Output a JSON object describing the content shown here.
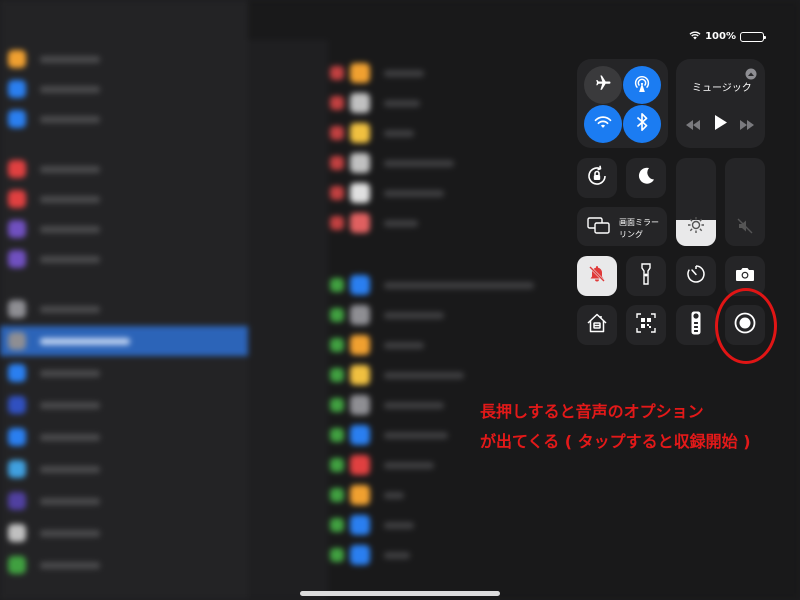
{
  "status_bar": {
    "battery_percent": "100%",
    "battery_level": 1.0
  },
  "control_center": {
    "music": {
      "title": "ミュージック"
    },
    "screen_mirroring": {
      "label_line1": "画面ミラー",
      "label_line2": "リング"
    },
    "brightness_level": 0.3,
    "volume_level": 0.0
  },
  "annotation": {
    "line1": "長押しすると音声のオプション",
    "line2": "が出てくる ( タップすると収録開始 )",
    "color": "#e31919"
  },
  "colors": {
    "accent_blue": "#1b7cf2",
    "annotation_red": "#e01515",
    "battery_green": "#34c759"
  },
  "icons": {
    "airplane": "airplane-icon",
    "airdrop": "airdrop-icon",
    "wifi": "wifi-icon",
    "bluetooth": "bluetooth-icon",
    "rotation_lock": "rotation-lock-icon",
    "do_not_disturb": "moon-icon",
    "mirroring": "screen-mirroring-icon",
    "brightness": "sun-icon",
    "volume": "speaker-muted-icon",
    "mute": "bell-slash-icon",
    "flashlight": "flashlight-icon",
    "timer": "timer-icon",
    "camera": "camera-icon",
    "home": "home-icon",
    "qr": "qr-code-icon",
    "remote": "tv-remote-icon",
    "screen_record": "screen-record-icon"
  }
}
